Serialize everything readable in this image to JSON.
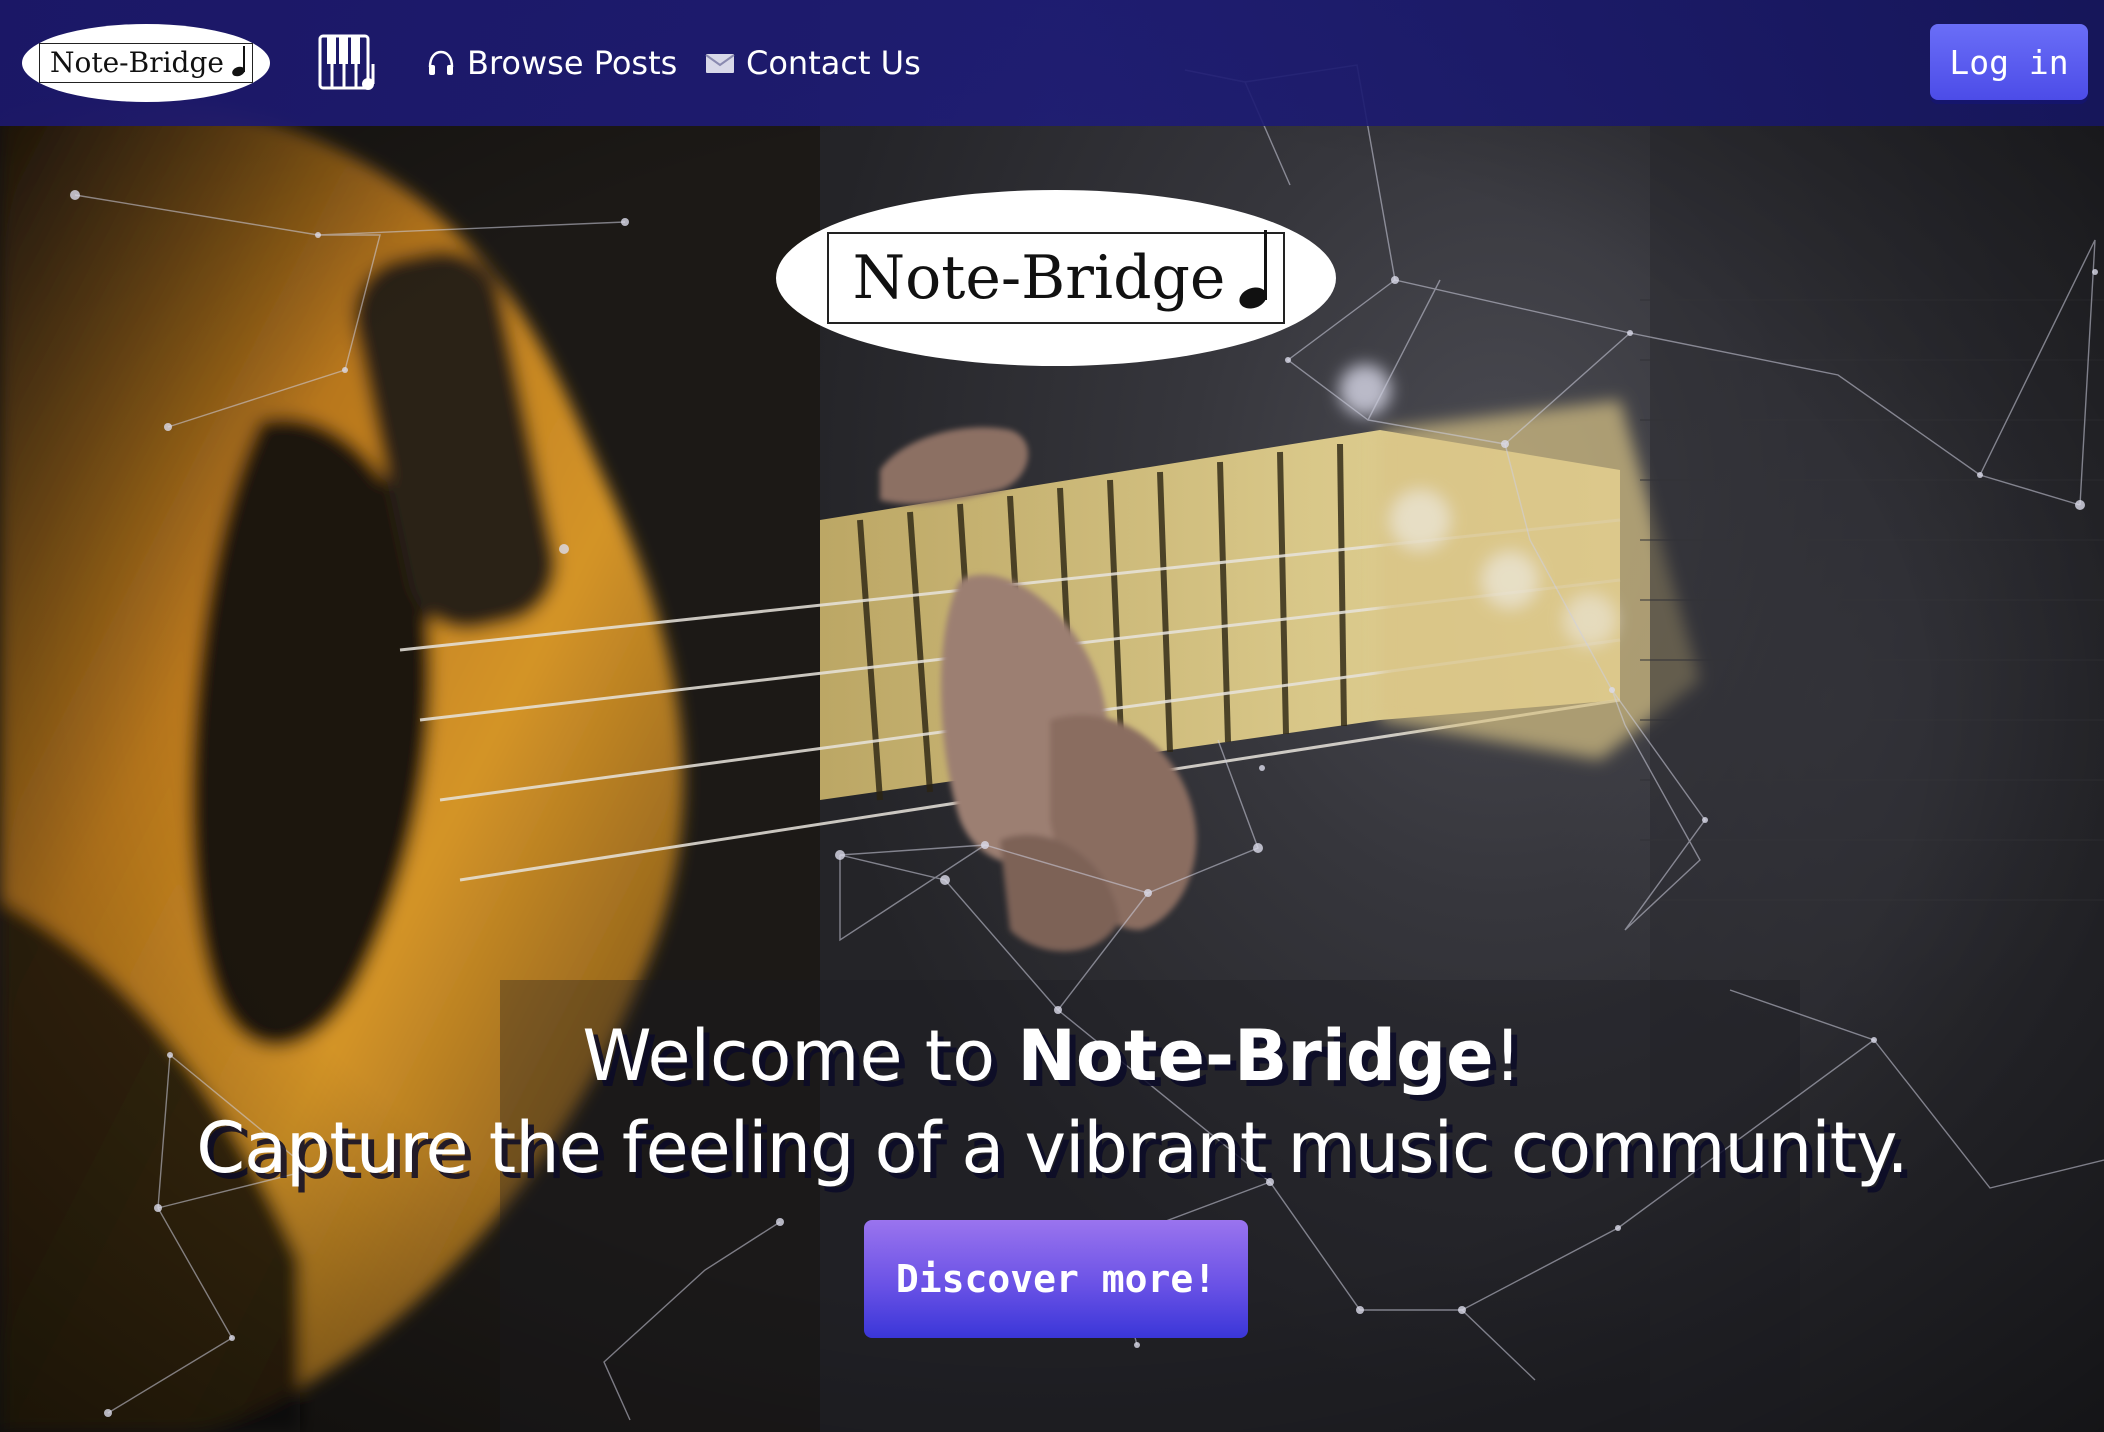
{
  "navbar": {
    "logo_text": "Note-Bridge",
    "piano_icon": "piano-keys-icon",
    "links": [
      {
        "label": "Browse Posts",
        "icon": "headphones-icon"
      },
      {
        "label": "Contact Us",
        "icon": "envelope-icon"
      }
    ],
    "login_label": "Log in"
  },
  "hero": {
    "logo_text": "Note-Bridge",
    "welcome_prefix": "Welcome to ",
    "welcome_brand": "Note-Bridge",
    "welcome_suffix": "!",
    "tagline": "Capture the feeling of a vibrant music community.",
    "cta_label": "Discover more!"
  },
  "colors": {
    "navbar": "#1e1c78",
    "login_button": "#5a5cf0",
    "cta_button": "#6a52e6",
    "text": "#ffffff"
  }
}
